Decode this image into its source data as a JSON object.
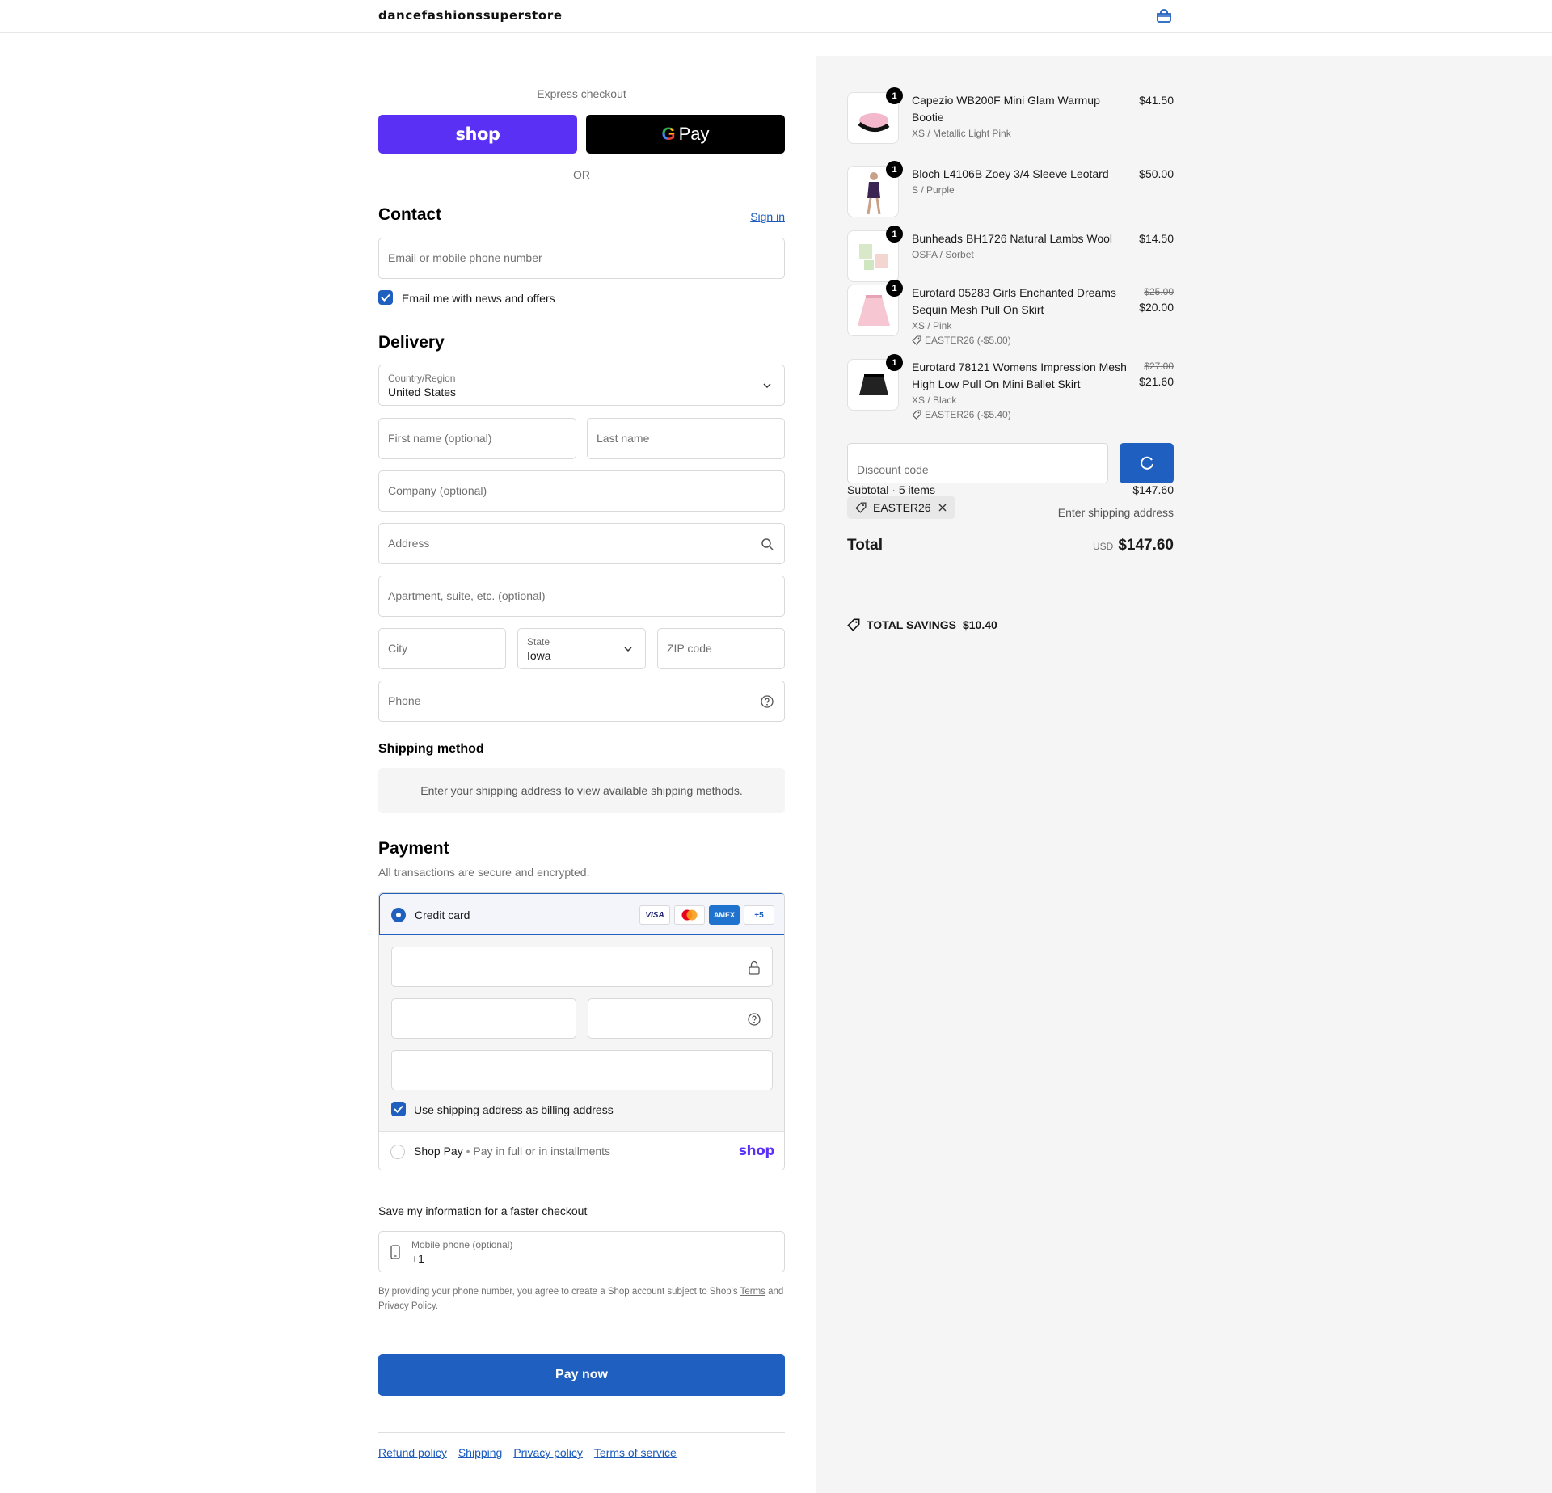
{
  "header": {
    "store_name": "dancefashionssuperstore",
    "cart_icon": "bag-icon"
  },
  "express": {
    "label": "Express checkout",
    "shop_label": "shop",
    "gpay_label": "Pay",
    "or_label": "OR"
  },
  "contact": {
    "title": "Contact",
    "sign_in": "Sign in",
    "email_placeholder": "Email or mobile phone number",
    "news_label": "Email me with news and offers",
    "news_checked": true
  },
  "delivery": {
    "title": "Delivery",
    "country_label": "Country/Region",
    "country_value": "United States",
    "first_name_placeholder": "First name (optional)",
    "last_name_placeholder": "Last name",
    "company_placeholder": "Company (optional)",
    "address_placeholder": "Address",
    "apartment_placeholder": "Apartment, suite, etc. (optional)",
    "city_placeholder": "City",
    "state_label": "State",
    "state_value": "Iowa",
    "zip_placeholder": "ZIP code",
    "phone_placeholder": "Phone"
  },
  "shipping": {
    "title": "Shipping method",
    "message": "Enter your shipping address to view available shipping methods."
  },
  "payment": {
    "title": "Payment",
    "subtitle": "All transactions are secure and encrypted.",
    "credit_card_label": "Credit card",
    "card_icons": [
      "VISA",
      "mastercard",
      "AMEX",
      "+5"
    ],
    "billing_label": "Use shipping address as billing address",
    "billing_checked": true,
    "shop_pay_label": "Shop Pay",
    "shop_pay_sub": "Pay in full or in installments",
    "shop_pay_logo": "shop"
  },
  "save_info": {
    "title": "Save my information for a faster checkout",
    "phone_label": "Mobile phone (optional)",
    "phone_value": "+1",
    "terms_prefix": "By providing your phone number, you agree to create a Shop account subject to Shop's",
    "terms_link": "Terms",
    "terms_and": "and",
    "privacy_link": "Privacy Policy",
    "terms_end": "."
  },
  "pay_button": "Pay now",
  "footer": {
    "links": [
      "Refund policy",
      "Shipping",
      "Privacy policy",
      "Terms of service"
    ]
  },
  "summary": {
    "items": [
      {
        "qty": "1",
        "name": "Capezio WB200F Mini Glam Warmup Bootie",
        "variant": "XS / Metallic Light Pink",
        "price": "$41.50",
        "original_price": "",
        "discount": ""
      },
      {
        "qty": "1",
        "name": "Bloch L4106B Zoey 3/4 Sleeve Leotard",
        "variant": "S / Purple",
        "price": "$50.00",
        "original_price": "",
        "discount": ""
      },
      {
        "qty": "1",
        "name": "Bunheads BH1726 Natural Lambs Wool",
        "variant": "OSFA / Sorbet",
        "price": "$14.50",
        "original_price": "",
        "discount": ""
      },
      {
        "qty": "1",
        "name": "Eurotard 05283 Girls Enchanted Dreams Sequin Mesh Pull On Skirt",
        "variant": "XS / Pink",
        "price": "$20.00",
        "original_price": "$25.00",
        "discount": "EASTER26 (-$5.00)"
      },
      {
        "qty": "1",
        "name": "Eurotard 78121 Womens Impression Mesh High Low Pull On Mini Ballet Skirt",
        "variant": "XS / Black",
        "price": "$21.60",
        "original_price": "$27.00",
        "discount": "EASTER26 (-$5.40)"
      }
    ],
    "discount_placeholder": "Discount code",
    "subtotal_label": "Subtotal · 5 items",
    "subtotal_value": "$147.60",
    "applied_code": "EASTER26",
    "shipping_value": "Enter shipping address",
    "total_label": "Total",
    "currency": "USD",
    "total_value": "$147.60",
    "savings_label": "TOTAL SAVINGS",
    "savings_value": "$10.40"
  },
  "colors": {
    "accent": "#1f5fbf",
    "shop_purple": "#5a31f4",
    "summary_bg": "#f5f5f5"
  }
}
